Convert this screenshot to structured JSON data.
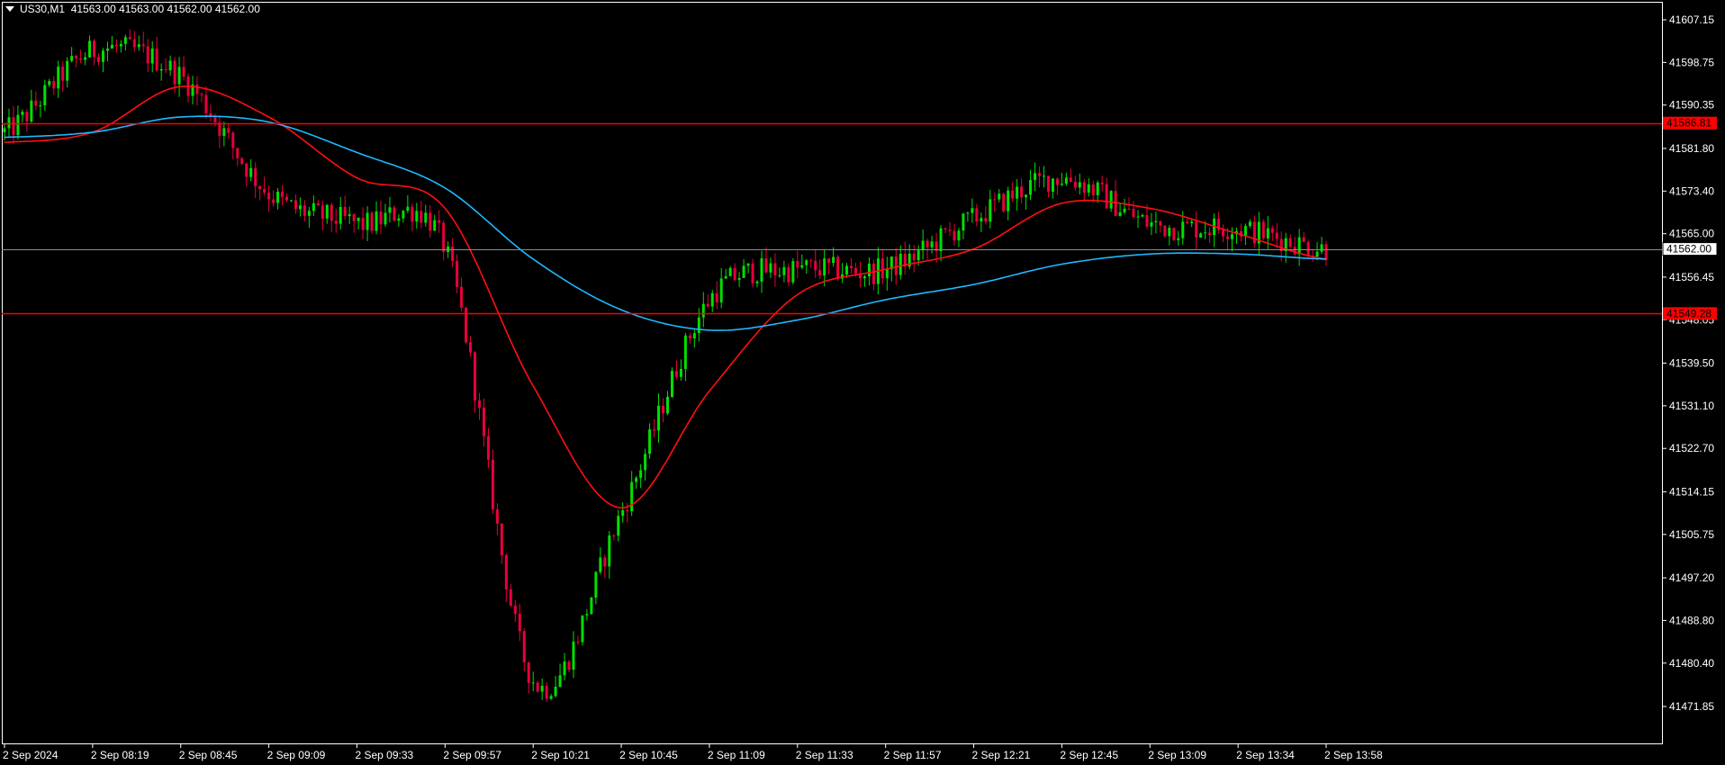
{
  "header": {
    "symbol": "US30,M1",
    "ohlc": "41563.00 41563.00 41562.00 41562.00"
  },
  "price_axis": {
    "labels": [
      "41607.15",
      "41598.75",
      "41590.35",
      "41581.80",
      "41573.40",
      "41565.00",
      "41556.45",
      "41548.05",
      "41539.50",
      "41531.10",
      "41522.70",
      "41514.15",
      "41505.75",
      "41497.20",
      "41488.80",
      "41480.40",
      "41471.85"
    ]
  },
  "time_axis": {
    "labels": [
      "2 Sep 2024",
      "2 Sep 08:19",
      "2 Sep 08:45",
      "2 Sep 09:09",
      "2 Sep 09:33",
      "2 Sep 09:57",
      "2 Sep 10:21",
      "2 Sep 10:45",
      "2 Sep 11:09",
      "2 Sep 11:33",
      "2 Sep 11:57",
      "2 Sep 12:21",
      "2 Sep 12:45",
      "2 Sep 13:09",
      "2 Sep 13:34",
      "2 Sep 13:58"
    ]
  },
  "levels": {
    "resistance": {
      "label": "41586.81",
      "price": 41586.81,
      "color": "#ff0000"
    },
    "support": {
      "label": "41549.28",
      "price": 41549.28,
      "color": "#ff0000"
    },
    "current": {
      "label": "41562.00",
      "price": 41562.0,
      "color": "#7f8ea0"
    }
  },
  "colors": {
    "bull": "#00e000",
    "bear": "#e8003c",
    "ma_fast": "#ff1010",
    "ma_slow": "#1fb8ff",
    "background": "#000000",
    "foreground": "#ffffff"
  },
  "chart_data": {
    "type": "line",
    "title": "US30,M1",
    "xlabel": "",
    "ylabel": "",
    "ylim": [
      41469.5,
      41610
    ],
    "x": [
      "2 Sep 2024",
      "2 Sep 08:19",
      "2 Sep 08:45",
      "2 Sep 09:09",
      "2 Sep 09:33",
      "2 Sep 09:57",
      "2 Sep 10:21",
      "2 Sep 10:45",
      "2 Sep 11:09",
      "2 Sep 11:33",
      "2 Sep 11:57",
      "2 Sep 12:21",
      "2 Sep 12:45",
      "2 Sep 13:09",
      "2 Sep 13:34",
      "2 Sep 13:58"
    ],
    "series": [
      {
        "values": [
          41585,
          41601,
          41596,
          41573,
          41567,
          41562,
          41477,
          41510,
          41552,
          41558,
          41558,
          41568,
          41576,
          41567,
          41566,
          41562
        ]
      },
      {
        "values": [
          41583,
          41585,
          41594,
          41588,
          41576,
          41570,
          41535,
          41511,
          41534,
          41553,
          41558,
          41562,
          41571,
          41570,
          41565,
          41560
        ]
      },
      {
        "values": [
          41584,
          41585,
          41588,
          41587,
          41581,
          41574,
          41560,
          41550,
          41546,
          41548,
          41552,
          41555,
          41559,
          41561,
          41561,
          41560
        ]
      }
    ]
  }
}
